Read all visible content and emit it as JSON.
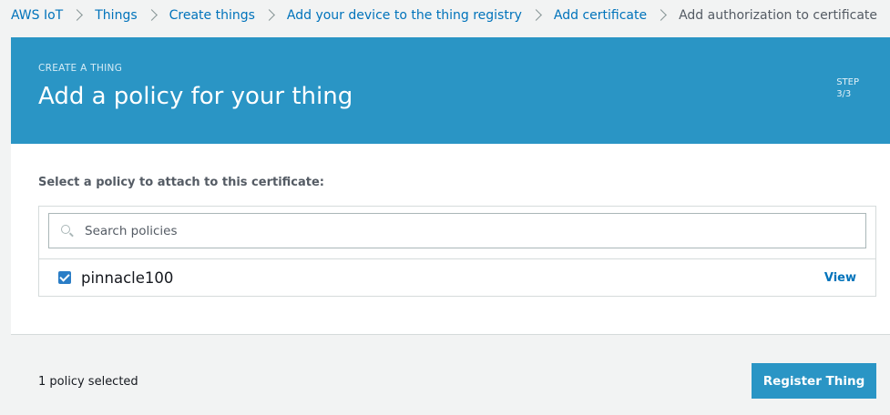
{
  "breadcrumb": {
    "items": [
      {
        "label": "AWS IoT"
      },
      {
        "label": "Things"
      },
      {
        "label": "Create things"
      },
      {
        "label": "Add your device to the thing registry"
      },
      {
        "label": "Add certificate"
      }
    ],
    "current": "Add authorization to certificate"
  },
  "header": {
    "eyebrow": "CREATE A THING",
    "title": "Add a policy for your thing",
    "step_label": "STEP",
    "step_value": "3/3",
    "background_color": "#2a95c5"
  },
  "policy_select": {
    "instruction": "Select a policy to attach to this certificate:",
    "search_placeholder": "Search policies",
    "search_icon": "search-icon",
    "policies": [
      {
        "name": "pinnacle100",
        "checked": true,
        "view_label": "View"
      }
    ]
  },
  "footer": {
    "selected_count": "1 policy selected",
    "register_label": "Register Thing"
  },
  "colors": {
    "link": "#0073bb",
    "primary_button": "#2a95c5"
  }
}
